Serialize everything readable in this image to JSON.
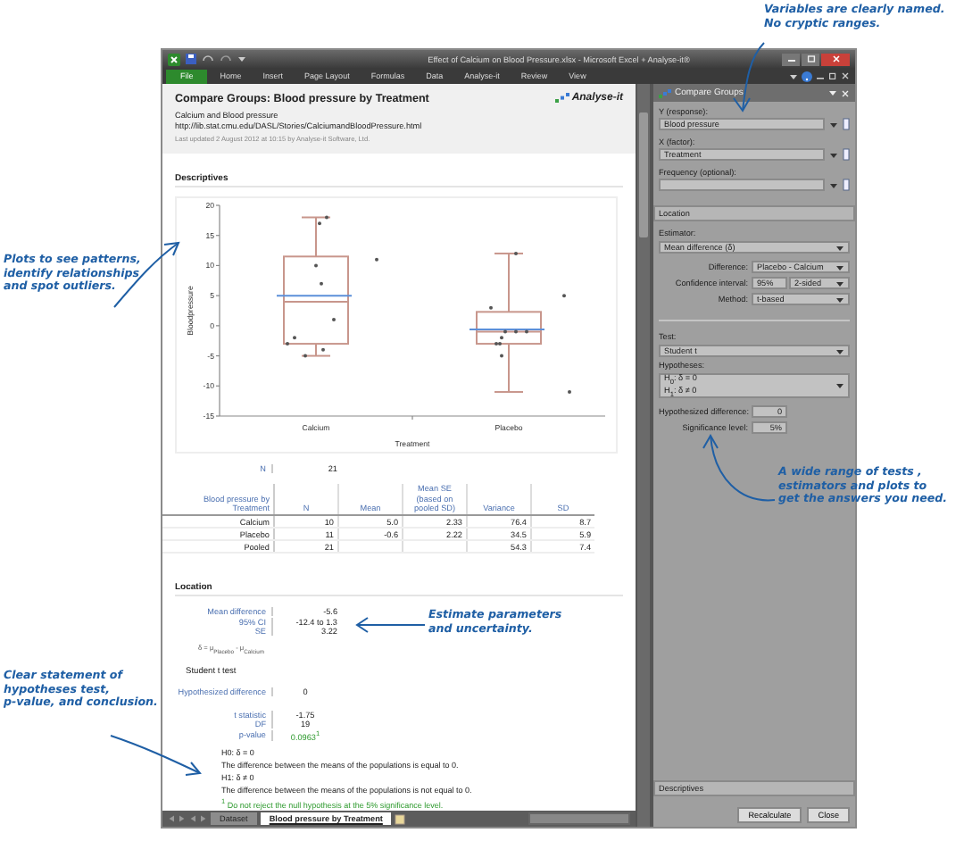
{
  "window": {
    "title": "Effect of Calcium on Blood Pressure.xlsx - Microsoft Excel + Analyse-it®"
  },
  "ribbon_tabs": [
    {
      "label": "File",
      "selected": true
    },
    {
      "label": "Home",
      "selected": false
    },
    {
      "label": "Insert",
      "selected": false
    },
    {
      "label": "Page Layout",
      "selected": false
    },
    {
      "label": "Formulas",
      "selected": false
    },
    {
      "label": "Data",
      "selected": false
    },
    {
      "label": "Analyse-it",
      "selected": false
    },
    {
      "label": "Review",
      "selected": false
    },
    {
      "label": "View",
      "selected": false
    }
  ],
  "report": {
    "title": "Compare Groups: Blood pressure by Treatment",
    "subtitle": "Calcium and Blood pressure",
    "url": "http://lib.stat.cmu.edu/DASL/Stories/CalciumandBloodPressure.html",
    "updated": "Last updated 2 August 2012 at 10:15 by Analyse-it Software, Ltd.",
    "logo": "Analyse-it",
    "descriptives": {
      "heading": "Descriptives",
      "box_plot": {
        "xlabel": "Treatment",
        "ylabel": "Bloodpressure",
        "yticks": [
          "20",
          "15",
          "10",
          "5",
          "0",
          "-5",
          "-10",
          "-15"
        ],
        "groups": [
          "Calcium",
          "Placebo"
        ]
      },
      "n_label": "N",
      "n_value": "21",
      "table": {
        "columns": [
          "Blood pressure by Treatment",
          "N",
          "Mean",
          "Mean SE (based on pooled SD)",
          "Variance",
          "SD"
        ],
        "rows": [
          [
            "Calcium",
            "10",
            "5.0",
            "2.33",
            "76.4",
            "8.7"
          ],
          [
            "Placebo",
            "11",
            "-0.6",
            "2.22",
            "34.5",
            "5.9"
          ],
          [
            "Pooled",
            "21",
            null,
            null,
            "54.3",
            "7.4"
          ]
        ]
      }
    },
    "location": {
      "heading": "Location",
      "stats": [
        {
          "label": "Mean difference",
          "value": "-5.6"
        },
        {
          "label": "95% CI",
          "value": "-12.4 to 1.3"
        },
        {
          "label": "SE",
          "value": "3.22"
        }
      ],
      "formula": "δ = μ$_{Placebo}$ - μ$_{Calcium}$",
      "test_title": "Student t test",
      "hypothesized": {
        "label": "Hypothesized difference",
        "value": "0"
      },
      "test_stats": [
        {
          "label": "t statistic",
          "value": "-1.75",
          "kind": "plain"
        },
        {
          "label": "DF",
          "value": "19",
          "kind": "plain"
        },
        {
          "label": "p-value",
          "value": "0.0963$^{1}$",
          "kind": "highlight"
        }
      ],
      "hypotheses": [
        "H0: δ = 0",
        "The difference between the means of the populations is equal to 0.",
        "H1: δ ≠ 0",
        "The difference between the means of the populations is not equal to 0."
      ],
      "conclusion": "$^{1}$ Do not reject the null hypothesis at the 5% significance level."
    }
  },
  "sheet_tabs": [
    {
      "label": "Dataset",
      "selected": false
    },
    {
      "label": "Blood pressure by Treatment",
      "selected": true
    }
  ],
  "task_pane": {
    "title": "Compare Groups",
    "variables": [
      {
        "label": "Y (response):",
        "value": "Blood pressure"
      },
      {
        "label": "X (factor):",
        "value": "Treatment"
      },
      {
        "label": "Frequency (optional):"
      }
    ],
    "section": "Location",
    "estimator_label": "Estimator:",
    "estimator": "Mean difference (δ)",
    "fields": [
      {
        "label": "Difference:",
        "value": "Placebo - Calcium"
      },
      {
        "label": "Confidence interval:",
        "value": "95%",
        "option": "2-sided"
      },
      {
        "label": "Method:",
        "value": "t-based"
      }
    ],
    "test_label": "Test:",
    "test": "Student t",
    "hypotheses_label": "Hypotheses:",
    "hypotheses": [
      "H$_{0}$: δ = 0",
      "H$_{1}$: δ ≠ 0"
    ],
    "inputs": [
      {
        "label": "Hypothesized difference:",
        "value": "0"
      },
      {
        "label": "Significance level:",
        "value": "5%"
      }
    ],
    "collapsed_section": "Descriptives",
    "buttons": [
      "Recalculate",
      "Close"
    ]
  },
  "annotations": [
    {
      "lines": [
        "Variables are clearly named.",
        "No cryptic ranges."
      ]
    },
    {
      "lines": [
        "Plots to see patterns,",
        "identify relationships",
        "and spot outliers."
      ]
    },
    {
      "lines": [
        "A wide range of tests ,",
        "estimators and plots to",
        "get the answers you need."
      ]
    },
    {
      "lines": [
        "Estimate parameters",
        "and uncertainty."
      ]
    },
    {
      "lines": [
        "Clear statement of",
        "hypotheses test,",
        "p-value, and conclusion."
      ]
    }
  ]
}
